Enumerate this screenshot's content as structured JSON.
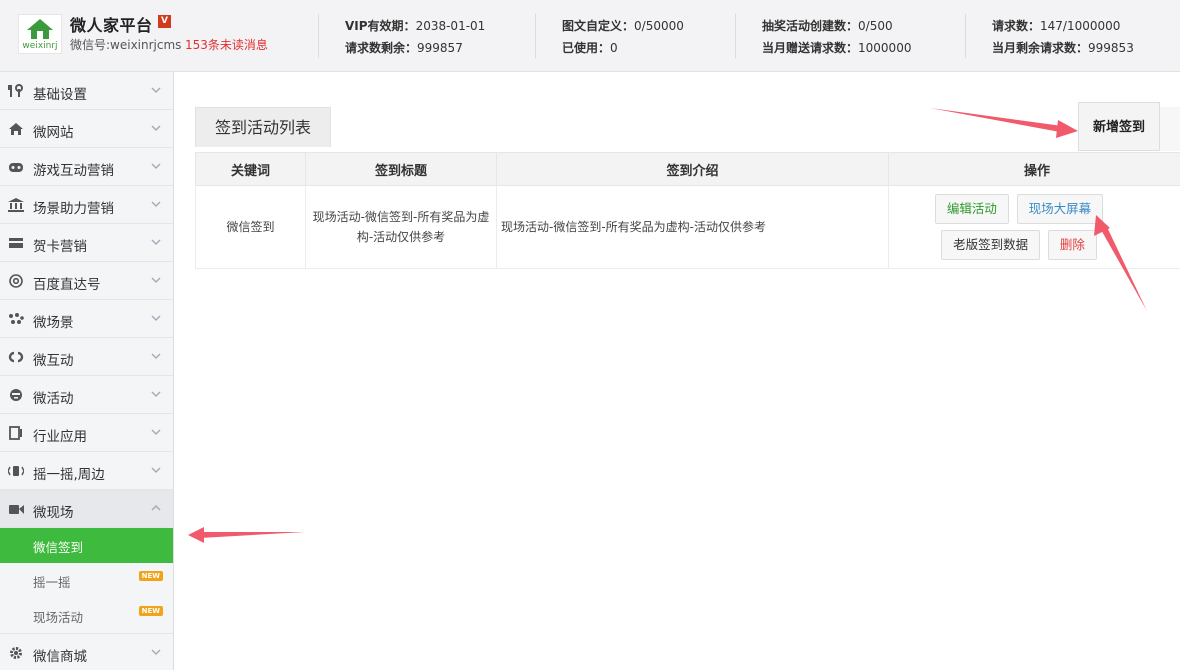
{
  "header": {
    "brand": "微人家平台",
    "brand_badge": "V",
    "logo_text": "weixinrj",
    "wechat_id": "微信号:weixinrjcms",
    "unread": "153条未读消息",
    "stats": [
      {
        "label": "VIP有效期：",
        "value": "2038-01-01"
      },
      {
        "label": "请求数剩余：",
        "value": "999857"
      },
      {
        "label": "图文自定义：",
        "value": "0/50000"
      },
      {
        "label": "已使用：",
        "value": "0"
      },
      {
        "label": "抽奖活动创建数：",
        "value": "0/500"
      },
      {
        "label": "当月赠送请求数：",
        "value": "1000000"
      },
      {
        "label": "请求数：",
        "value": "147/1000000"
      },
      {
        "label": "当月剩余请求数：",
        "value": "999853"
      }
    ]
  },
  "sidebar": {
    "items": [
      {
        "label": "基础设置",
        "icon": "tools-icon"
      },
      {
        "label": "微网站",
        "icon": "home-icon"
      },
      {
        "label": "游戏互动营销",
        "icon": "gamepad-icon"
      },
      {
        "label": "场景助力营销",
        "icon": "bank-icon"
      },
      {
        "label": "贺卡营销",
        "icon": "card-icon"
      },
      {
        "label": "百度直达号",
        "icon": "at-icon"
      },
      {
        "label": "微场景",
        "icon": "dots-icon"
      },
      {
        "label": "微互动",
        "icon": "link-icon"
      },
      {
        "label": "微活动",
        "icon": "face-icon"
      },
      {
        "label": "行业应用",
        "icon": "doc-icon"
      },
      {
        "label": "摇一摇,周边",
        "icon": "shake-icon"
      },
      {
        "label": "微现场",
        "icon": "video-icon"
      }
    ],
    "sub_items": [
      {
        "label": "微信签到"
      },
      {
        "label": "摇一摇",
        "badge": "NEW"
      },
      {
        "label": "现场活动",
        "badge": "NEW"
      }
    ],
    "last_item": {
      "label": "微信商城",
      "icon": "gear-icon"
    }
  },
  "main": {
    "tab_label": "签到活动列表",
    "add_button": "新增签到",
    "columns": [
      "关键词",
      "签到标题",
      "签到介绍",
      "操作"
    ],
    "rows": [
      {
        "keyword": "微信签到",
        "title": "现场活动-微信签到-所有奖品为虚构-活动仅供参考",
        "intro": "现场活动-微信签到-所有奖品为虚构-活动仅供参考",
        "actions": {
          "edit": "编辑活动",
          "screen": "现场大屏幕",
          "old": "老版签到数据",
          "delete": "删除"
        }
      }
    ]
  },
  "colors": {
    "accent": "#3ebb3e",
    "danger": "#e33d3d",
    "link": "#3a8cc7",
    "arrow": "#f05a6a"
  }
}
